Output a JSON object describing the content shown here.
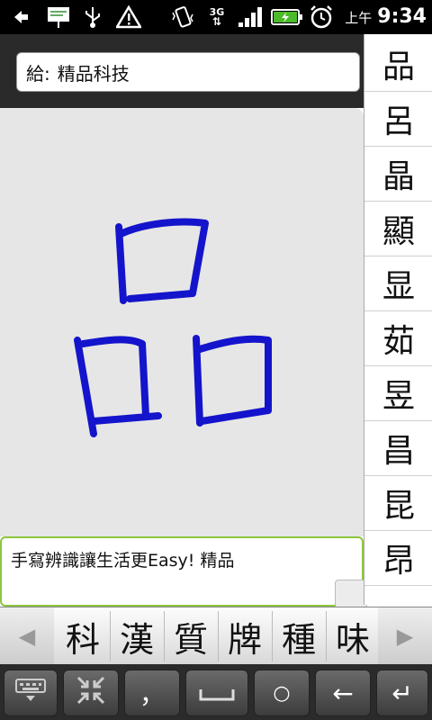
{
  "status_bar": {
    "ampm": "上午",
    "time": "9:34",
    "network": "3G"
  },
  "recipient": {
    "label": "給:",
    "name": "精品科技"
  },
  "message": {
    "text": "手寫辨識讓生活更Easy!  精品"
  },
  "ink_color": "#1414cc",
  "candidates_column": [
    "品",
    "呂",
    "晶",
    "顯",
    "显",
    "茹",
    "昱",
    "昌",
    "昆",
    "昂"
  ],
  "candidates_row": [
    "科",
    "漢",
    "質",
    "牌",
    "種",
    "味"
  ],
  "keyboard": {
    "comma": "，",
    "space": "␣",
    "dot": "○",
    "backspace": "←",
    "enter": "↵"
  }
}
